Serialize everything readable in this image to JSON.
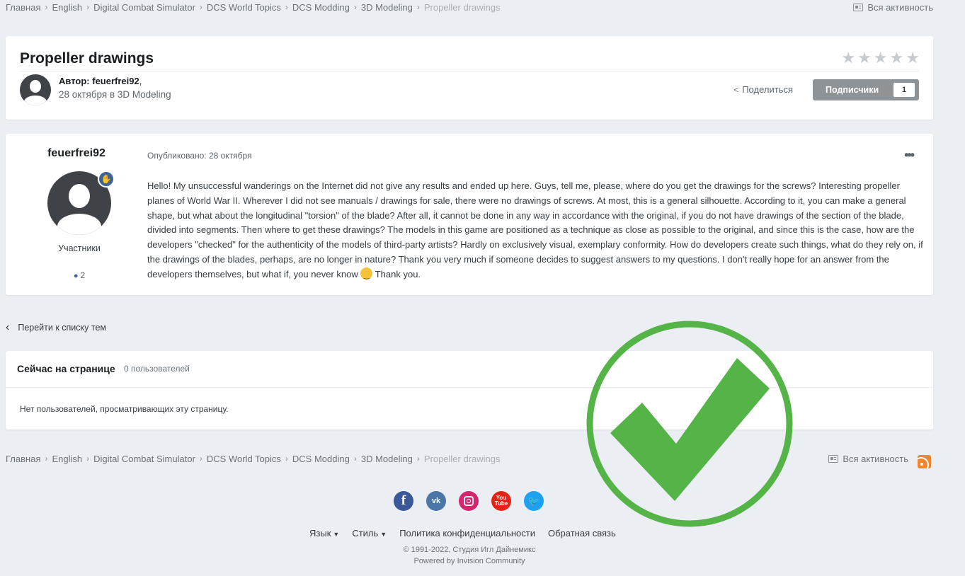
{
  "breadcrumb": {
    "items": [
      "Главная",
      "English",
      "Digital Combat Simulator",
      "DCS World Topics",
      "DCS Modding",
      "3D Modeling",
      "Propeller drawings"
    ]
  },
  "activity_label": "Вся активность",
  "topic": {
    "title": "Propeller drawings",
    "rating": {
      "max": 5,
      "value": 0
    },
    "author_prefix": "Автор:",
    "author": "feuerfrei92",
    "author_suffix": ",",
    "date_line": "28 октября в 3D Modeling",
    "share_label": "Поделиться",
    "follow_label": "Подписчики",
    "follow_count": "1"
  },
  "post": {
    "author": "feuerfrei92",
    "group": "Участники",
    "post_count": "2",
    "posted_on": "Опубликовано: 28 октября",
    "text": "Hello! My unsuccessful wanderings on the Internet did not give any results and ended up here. Guys, tell me, please, where do you get the drawings for the screws? Interesting propeller planes of World War II. Wherever I did not see manuals / drawings for sale, there were no drawings of screws. At most, this is a general silhouette. According to it, you can make a general shape, but what about the longitudinal \"torsion\" of the blade? After all, it cannot be done in any way in accordance with the original, if you do not have drawings of the section of the blade, divided into segments. Then where to get these drawings? The models in this game are positioned as a technique as close as possible to the original, and since this is the case, how are the developers \"checked\" for the authenticity of the models of third-party artists? Hardly on exclusively visual, exemplary conformity. How do developers create such things, what do they rely on, if the drawings of the blades, perhaps, are no longer in nature? Thank you very much if someone decides to suggest answers to my questions. I don't really hope for an answer from the developers themselves, but what if, you never know",
    "text_end": " Thank you."
  },
  "back_link": "Перейти к списку тем",
  "online": {
    "title": "Сейчас на странице",
    "count": "0 пользователей",
    "empty": "Нет пользователей, просматривающих эту страницу."
  },
  "social_icons": [
    "facebook-icon",
    "vk-icon",
    "instagram-icon",
    "youtube-icon",
    "twitter-icon"
  ],
  "footer": {
    "language": "Язык",
    "theme": "Стиль",
    "privacy": "Политика конфиденциальности",
    "contact": "Обратная связь",
    "copyright": "© 1991-2022, Студия Игл Дайнемикс",
    "powered": "Powered by Invision Community"
  },
  "colors": {
    "accent": "#3d6594",
    "check_green": "#54b447",
    "follow_button": "#8e9398"
  }
}
